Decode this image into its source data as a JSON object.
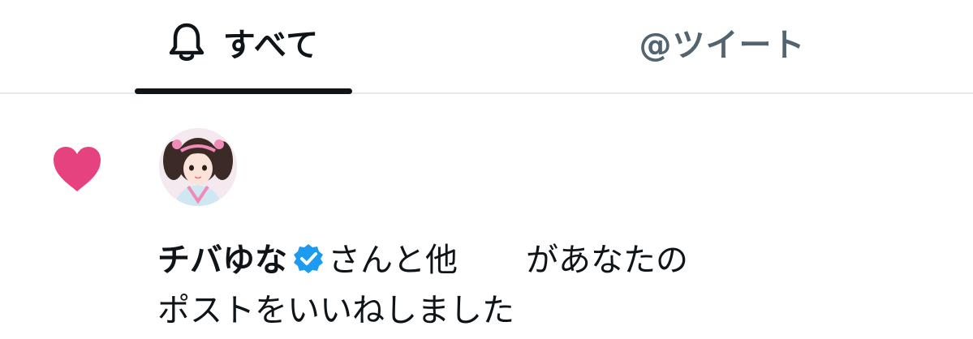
{
  "tabs": {
    "all_label": "すべて",
    "mentions_label": "@ツイート"
  },
  "notification": {
    "user_name": "チバゆな",
    "text_after_name": "さんと他",
    "text_line1_end": "があなたの",
    "text_line2": "ポストをいいねしました"
  },
  "icons": {
    "tab_all": "bell-icon",
    "notification_type": "heart-icon",
    "verified": "verified-badge-icon"
  },
  "colors": {
    "like": "#e6427f",
    "verified": "#1d9bf0",
    "active_text": "#0f1419",
    "inactive_text": "#536471"
  }
}
